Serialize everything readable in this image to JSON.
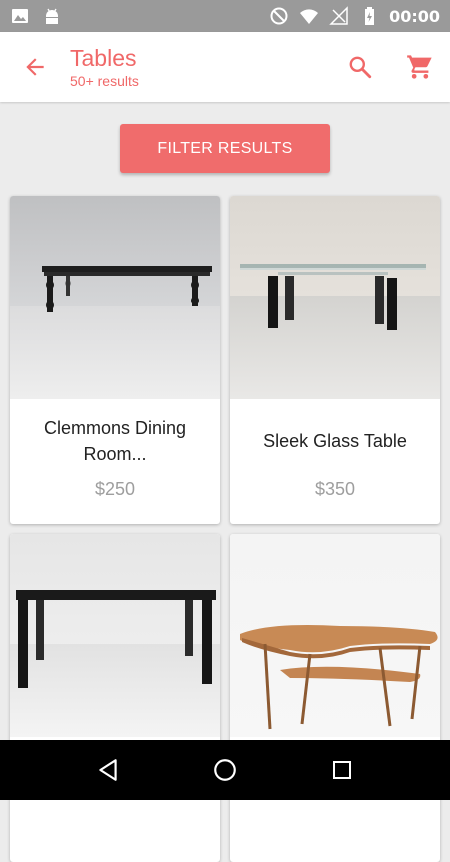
{
  "status_bar": {
    "time": "00:00",
    "left_icons": [
      "image-icon",
      "android-icon"
    ],
    "right_icons": [
      "do-not-disturb-icon",
      "wifi-icon",
      "signal-icon",
      "battery-charging-icon"
    ]
  },
  "app_bar": {
    "title": "Tables",
    "subtitle": "50+ results",
    "back_icon": "arrow-back-icon",
    "actions": [
      "search-icon",
      "cart-icon"
    ]
  },
  "filter": {
    "label": "FILTER RESULTS"
  },
  "products": [
    {
      "name": "Clemmons Dining Room...",
      "price": "$250"
    },
    {
      "name": "Sleek Glass Table",
      "price": "$350"
    },
    {
      "name": "",
      "price": ""
    },
    {
      "name": "",
      "price": ""
    }
  ],
  "colors": {
    "accent": "#f06868",
    "button": "#f06c6c",
    "status_bar": "#9a9a9a",
    "background": "#ececec",
    "price": "#9e9e9e"
  },
  "nav_bar": {
    "icons": [
      "back-triangle-icon",
      "home-circle-icon",
      "recents-square-icon"
    ]
  }
}
